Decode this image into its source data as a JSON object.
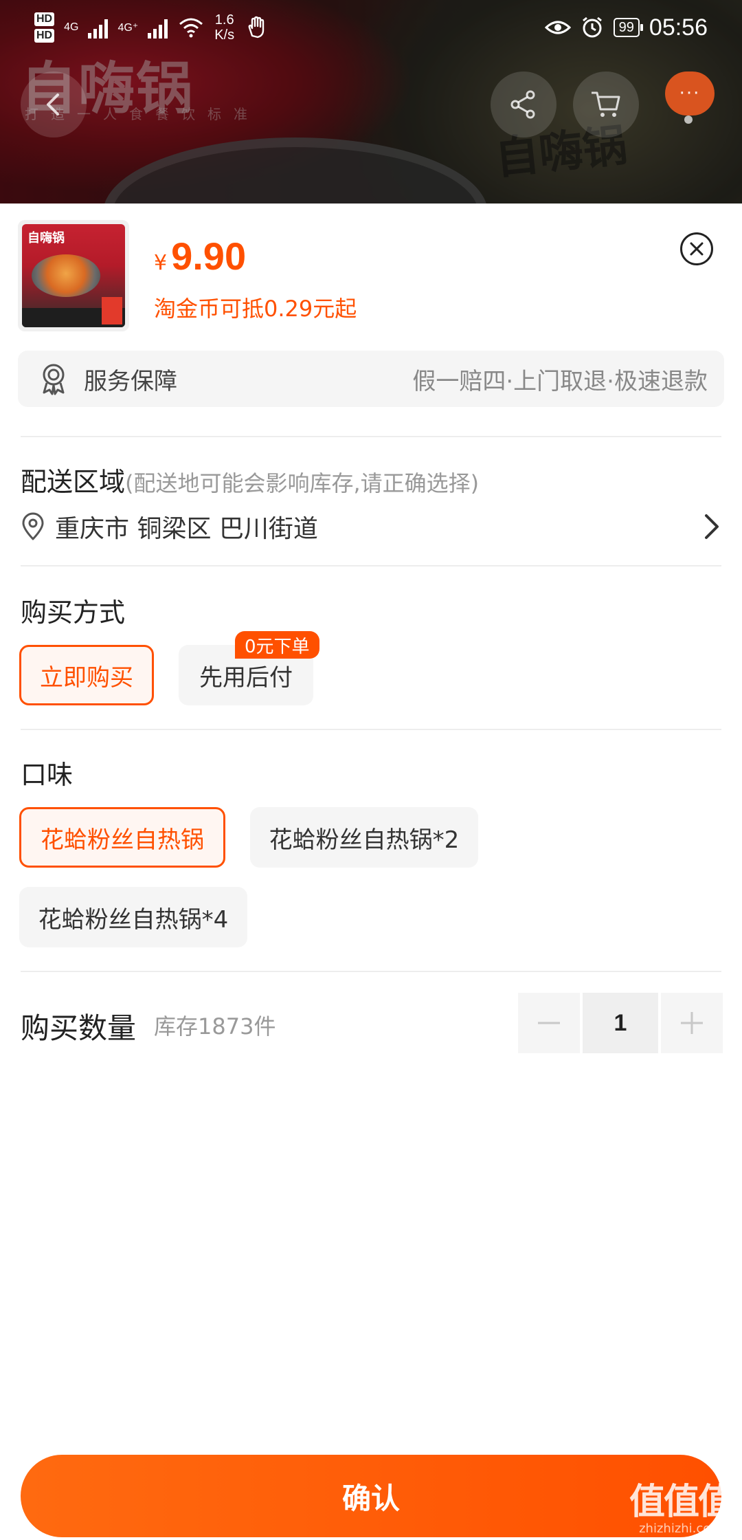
{
  "status_bar": {
    "hd1": "HD",
    "hd2": "HD",
    "net1": "4G",
    "net2": "4G⁺",
    "speed_value": "1.6",
    "speed_unit": "K/s",
    "battery": "99",
    "time": "05:56"
  },
  "banner": {
    "brand": "自嗨锅",
    "brand_sub": "打造一人食餐饮标准",
    "brand_right": "自嗨锅",
    "more_label": "···"
  },
  "product": {
    "thumb_logo": "自嗨锅",
    "currency": "¥",
    "price": "9.90",
    "coin_note": "淘金币可抵0.29元起"
  },
  "service": {
    "title": "服务保障",
    "detail": "假一赔四·上门取退·极速退款"
  },
  "delivery": {
    "title": "配送区域",
    "hint": "(配送地可能会影响库存,请正确选择)",
    "address": "重庆市 铜梁区 巴川街道"
  },
  "purchase_method": {
    "title": "购买方式",
    "options": [
      {
        "label": "立即购买",
        "selected": true
      },
      {
        "label": "先用后付",
        "selected": false,
        "badge": "0元下单"
      }
    ]
  },
  "flavor": {
    "title": "口味",
    "options": [
      {
        "label": "花蛤粉丝自热锅",
        "selected": true
      },
      {
        "label": "花蛤粉丝自热锅*2",
        "selected": false
      },
      {
        "label": "花蛤粉丝自热锅*4",
        "selected": false
      }
    ]
  },
  "quantity": {
    "label": "购买数量",
    "stock": "库存1873件",
    "value": "1"
  },
  "confirm_label": "确认",
  "watermark": {
    "logo": "值值值",
    "url": "zhizhizhi.com"
  },
  "colors": {
    "accent": "#ff5000",
    "option_bg": "#f5f5f5",
    "selected_bg": "#fff6f2",
    "hint_text": "#999999"
  },
  "icons": [
    "back-icon",
    "share-icon",
    "cart-icon",
    "more-icon",
    "close-icon",
    "service-badge-icon",
    "location-pin-icon",
    "chevron-right-icon",
    "minus-icon",
    "plus-icon",
    "eye-icon",
    "alarm-icon",
    "wifi-icon",
    "gesture-icon"
  ]
}
